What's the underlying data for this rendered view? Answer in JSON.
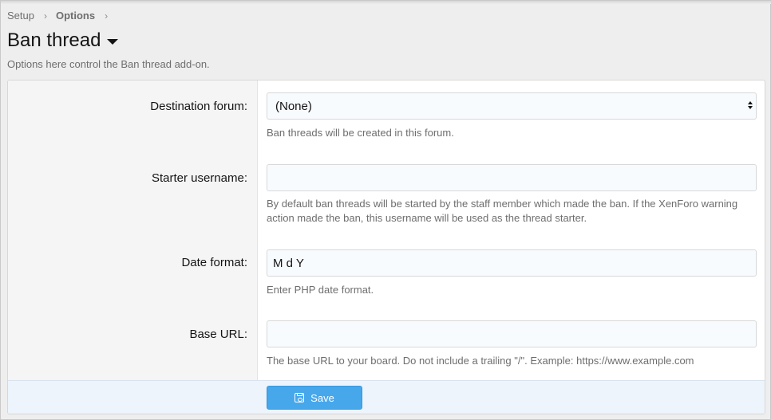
{
  "breadcrumb": {
    "items": [
      "Setup",
      "Options"
    ],
    "separator": "›"
  },
  "header": {
    "title": "Ban thread",
    "description": "Options here control the Ban thread add-on."
  },
  "form": {
    "destination_forum": {
      "label": "Destination forum:",
      "value": "(None)",
      "hint": "Ban threads will be created in this forum."
    },
    "starter_username": {
      "label": "Starter username:",
      "value": "",
      "hint": "By default ban threads will be started by the staff member which made the ban. If the XenForo warning action made the ban, this username will be used as the thread starter."
    },
    "date_format": {
      "label": "Date format:",
      "value": "M d Y",
      "hint": "Enter PHP date format."
    },
    "base_url": {
      "label": "Base URL:",
      "value": "",
      "hint": "The base URL to your board. Do not include a trailing \"/\". Example: https://www.example.com"
    }
  },
  "footer": {
    "save_label": "Save",
    "save_icon": "save-icon"
  },
  "colors": {
    "accent": "#47a7eb",
    "footer_bg": "#edf4fb",
    "label_bg": "#f5f5f5"
  }
}
